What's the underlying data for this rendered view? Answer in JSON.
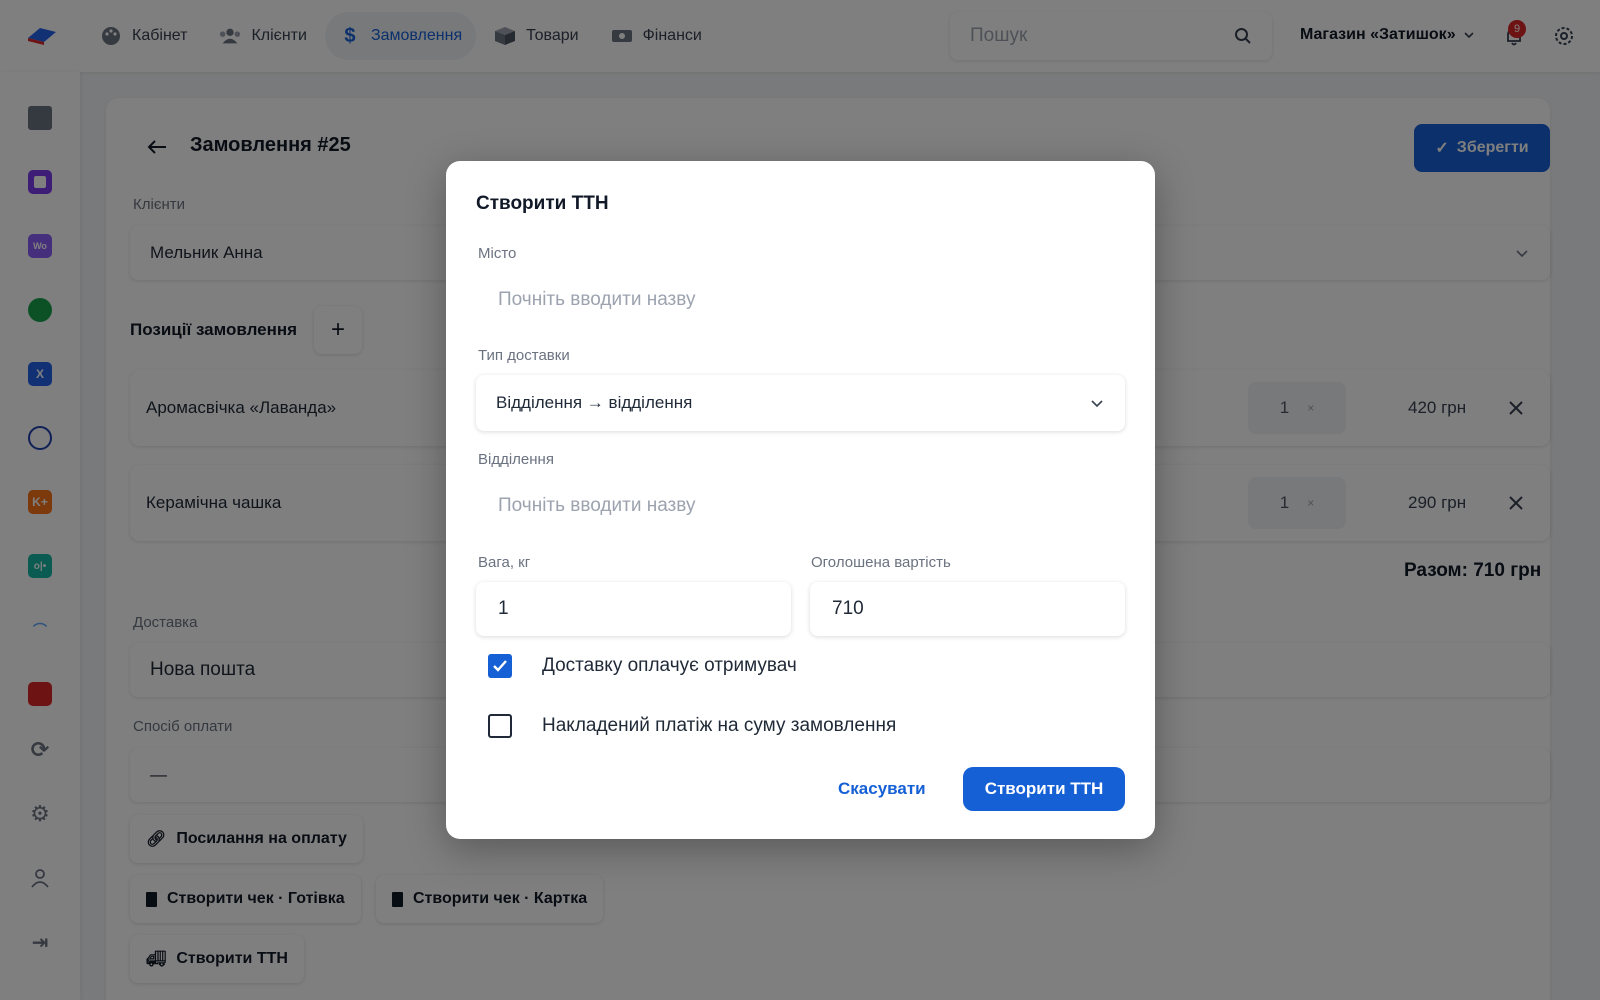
{
  "nav": {
    "items": [
      {
        "label": "Кабінет",
        "icon": "palette-icon"
      },
      {
        "label": "Клієнти",
        "icon": "users-icon"
      },
      {
        "label": "Замовлення",
        "icon": "dollar-icon"
      },
      {
        "label": "Товари",
        "icon": "box-icon"
      },
      {
        "label": "Фінанси",
        "icon": "money-icon"
      }
    ],
    "active": "Замовлення",
    "search_placeholder": "Пошук",
    "shop": "Магазин «Затишок»",
    "notifications": "9"
  },
  "order": {
    "title": "Замовлення #25",
    "save_label": "Зберегти",
    "client_label": "Клієнти",
    "client_value": "Мельник Анна",
    "items_title": "Позиції замовлення",
    "items": [
      {
        "name": "Аромасвічка «Лаванда»",
        "qty": "1",
        "price": "420 грн"
      },
      {
        "name": "Керамічна чашка",
        "qty": "1",
        "price": "290 грн"
      }
    ],
    "total": "Разом: 710 грн",
    "delivery_label": "Доставка",
    "delivery_value": "Нова пошта",
    "payment_label": "Спосіб оплати",
    "payment_value": "—",
    "actions": {
      "payment_link": "Посилання на оплату",
      "receipt_cash": "Створити чек · Готівка",
      "receipt_card": "Створити чек · Картка",
      "create_ttn": "Створити ТТН"
    }
  },
  "modal": {
    "title": "Створити ТТН",
    "city_label": "Місто",
    "city_placeholder": "Почніть вводити назву",
    "delivery_type_label": "Тип доставки",
    "delivery_type_value": "Відділення → відділення",
    "branch_label": "Відділення",
    "branch_placeholder": "Почніть вводити назву",
    "weight_label": "Вага, кг",
    "weight_value": "1",
    "declared_label": "Оголошена вартість",
    "declared_value": "710",
    "recipient_pays_label": "Доставку оплачує отримувач",
    "recipient_pays_checked": true,
    "cod_label": "Накладений платіж на суму замовлення",
    "cod_checked": false,
    "cancel_label": "Скасувати",
    "submit_label": "Створити ТТН"
  },
  "colors": {
    "accent": "#1660d6",
    "badge": "#dc2626",
    "overlay": "rgba(0,0,0,0.5)"
  }
}
